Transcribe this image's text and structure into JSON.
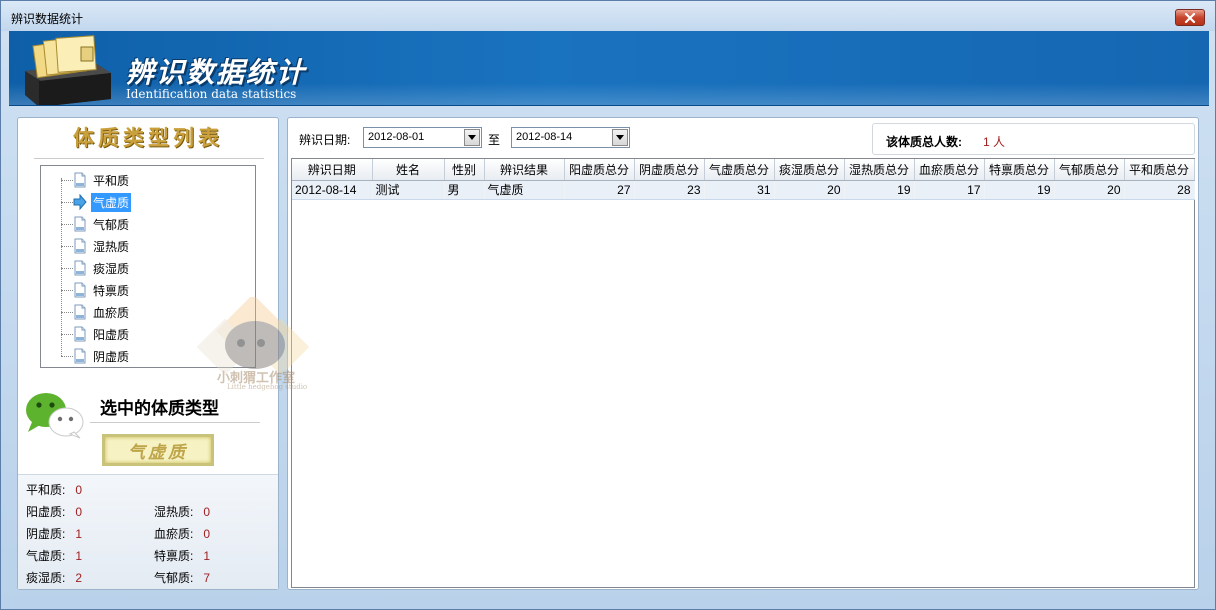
{
  "window": {
    "title": "辨识数据统计"
  },
  "banner": {
    "title": "辨识数据统计",
    "subtitle": "Identification data statistics"
  },
  "left": {
    "list_title": "体质类型列表",
    "items": [
      "平和质",
      "气虚质",
      "气郁质",
      "湿热质",
      "痰湿质",
      "特禀质",
      "血瘀质",
      "阳虚质",
      "阴虚质"
    ],
    "selected_index": 1,
    "selected_title": "选中的体质类型",
    "selected_value": "气虚质",
    "counts": [
      {
        "label": "平和质:",
        "value": "0"
      },
      {
        "label": "阳虚质:",
        "value": "0"
      },
      {
        "label": "湿热质:",
        "value": "0"
      },
      {
        "label": "阴虚质:",
        "value": "1"
      },
      {
        "label": "血瘀质:",
        "value": "0"
      },
      {
        "label": "气虚质:",
        "value": "1"
      },
      {
        "label": "特禀质:",
        "value": "1"
      },
      {
        "label": "痰湿质:",
        "value": "2"
      },
      {
        "label": "气郁质:",
        "value": "7"
      }
    ]
  },
  "filter": {
    "date_label": "辨识日期:",
    "from": "2012-08-01",
    "to_label": "至",
    "to": "2012-08-14",
    "total_label": "该体质总人数:",
    "total_value": "1 人"
  },
  "table": {
    "headers": [
      "辨识日期",
      "姓名",
      "性别",
      "辨识结果",
      "阳虚质总分",
      "阴虚质总分",
      "气虚质总分",
      "痰湿质总分",
      "湿热质总分",
      "血瘀质总分",
      "特禀质总分",
      "气郁质总分",
      "平和质总分"
    ],
    "rows": [
      [
        "2012-08-14",
        "测试",
        "男",
        "气虚质",
        "27",
        "23",
        "31",
        "20",
        "19",
        "17",
        "19",
        "20",
        "28"
      ]
    ]
  },
  "watermark": {
    "text": "小刺猬工作室",
    "sub": "Little hedgehog studio"
  },
  "colors": {
    "banner": "#1a73bf",
    "selection": "#3399ff",
    "value_red": "#a02020",
    "title_gold": "#c9a03c"
  },
  "icons": {
    "close": "close-icon",
    "logo": "folder-box-logo",
    "list_item": "document-icon",
    "selected_marker": "arrow-right-icon",
    "chat": "wechat-icon"
  }
}
